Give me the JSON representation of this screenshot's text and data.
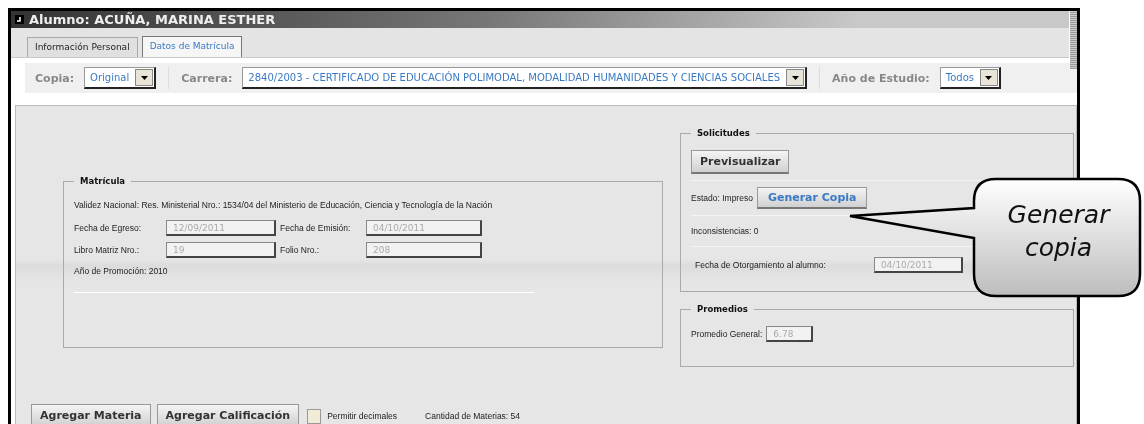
{
  "window": {
    "title": "Alumno: ACUÑA, MARINA ESTHER"
  },
  "tabs": [
    {
      "label": "Información Personal",
      "selected": false
    },
    {
      "label": "Datos de Matrícula",
      "selected": true
    }
  ],
  "filters": [
    {
      "label": "Copia:",
      "value": "Original"
    },
    {
      "label": "Carrera:",
      "value": "2840/2003 - CERTIFICADO DE EDUCACIÓN POLIMODAL, MODALIDAD HUMANIDADES Y CIENCIAS SOCIALES"
    },
    {
      "label": "Año de Estudio:",
      "value": "Todos"
    }
  ],
  "matricula": {
    "legend": "Matrícula",
    "validez": "Validez Nacional: Res. Ministerial Nro.: 1534/04 del Ministerio de Educación, Ciencia y Tecnología de la Nación",
    "fields": [
      {
        "label": "Fecha de Egreso:",
        "value": "12/09/2011"
      },
      {
        "label": "Fecha de Emisión:",
        "value": "04/10/2011"
      },
      {
        "label": "Libro Matriz Nro.:",
        "value": "19"
      },
      {
        "label": "Folio Nro.:",
        "value": "208"
      }
    ],
    "promocion": "Año de Promoción: 2010"
  },
  "solicitudes": {
    "legend": "Solicitudes",
    "preview_button": "Previsualizar",
    "estado": "Estado: Impreso",
    "generate_button": "Generar Copia",
    "inconsistencias": "Inconsistencias: 0",
    "otorgamiento": {
      "label": "Fecha de Otorgamiento al alumno:",
      "value": "04/10/2011"
    }
  },
  "promedios": {
    "legend": "Promedios",
    "label": "Promedio General:",
    "value": "6.78"
  },
  "actions": {
    "buttons": [
      "Agregar Materia",
      "Agregar Calificación"
    ],
    "decimals": {
      "label": "Permitir decimales",
      "checked": false
    },
    "count": "Cantidad de Materias: 54"
  },
  "callout": {
    "text": "Generar copia"
  }
}
